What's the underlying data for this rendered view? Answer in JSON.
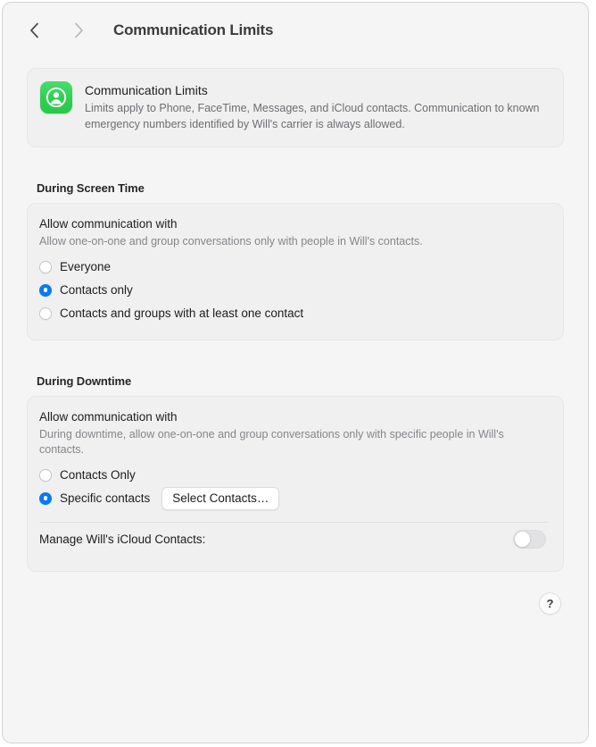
{
  "window": {
    "title": "Communication Limits"
  },
  "toolbar": {
    "back_icon": "chevron-left-icon",
    "forward_icon": "chevron-right-icon"
  },
  "banner": {
    "icon": "screen-time-contacts-icon",
    "icon_color": "#2fcf52",
    "title": "Communication Limits",
    "description": "Limits apply to Phone, FaceTime, Messages, and iCloud contacts. Communication to known emergency numbers identified by Will's carrier is always allowed."
  },
  "screen_time": {
    "section_title": "During Screen Time",
    "heading": "Allow communication with",
    "subtext": "Allow one-on-one and group conversations only with people in Will's contacts.",
    "selected": "Contacts only",
    "options": [
      {
        "label": "Everyone",
        "selected": false
      },
      {
        "label": "Contacts only",
        "selected": true
      },
      {
        "label": "Contacts and groups with at least one contact",
        "selected": false
      }
    ]
  },
  "downtime": {
    "section_title": "During Downtime",
    "heading": "Allow communication with",
    "subtext": "During downtime, allow one-on-one and group conversations only with specific people in Will's contacts.",
    "selected": "Specific contacts",
    "options": [
      {
        "label": "Contacts Only",
        "selected": false
      },
      {
        "label": "Specific contacts",
        "selected": true
      }
    ],
    "select_contacts_button": "Select Contacts…",
    "manage_label": "Manage Will's iCloud Contacts:",
    "manage_toggle_on": false
  },
  "help": {
    "glyph": "?",
    "icon": "question-mark-icon"
  },
  "accent_color": "#067bf2"
}
